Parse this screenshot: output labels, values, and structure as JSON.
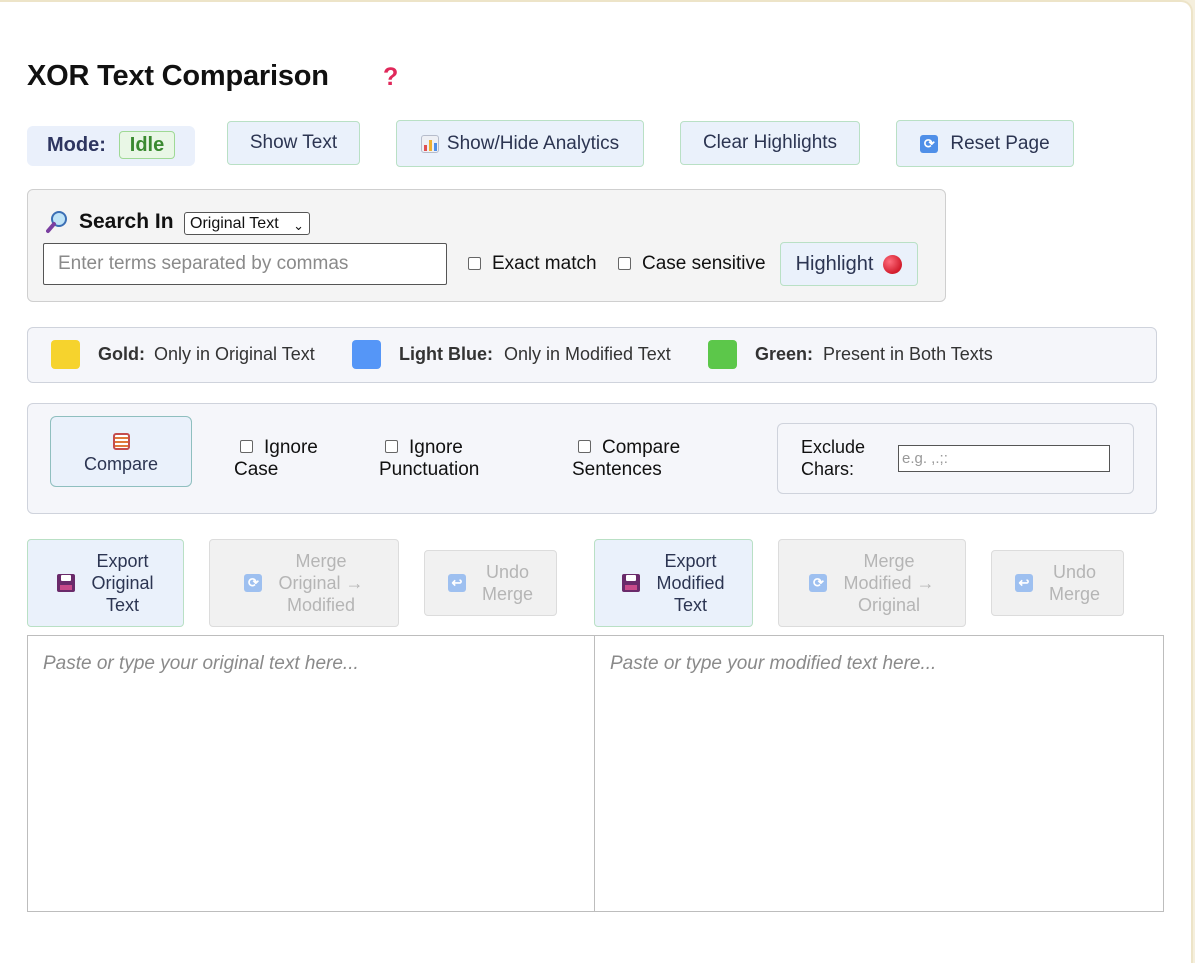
{
  "header": {
    "title": "XOR Text Comparison",
    "help_icon": "?"
  },
  "mode": {
    "label": "Mode:",
    "value": "Idle"
  },
  "toolbar": {
    "show_text": "Show Text",
    "show_hide_analytics": "Show/Hide Analytics",
    "clear_highlights": "Clear Highlights",
    "reset_page": "Reset Page"
  },
  "search": {
    "label": "Search In",
    "select_value": "Original Text",
    "placeholder": "Enter terms separated by commas",
    "exact_match": "Exact match",
    "case_sensitive": "Case sensitive",
    "highlight": "Highlight"
  },
  "legend": [
    {
      "key": "Gold:",
      "text": "Only in Original Text",
      "color": "#f6d32d"
    },
    {
      "key": "Light Blue:",
      "text": "Only in Modified Text",
      "color": "#5596f7"
    },
    {
      "key": "Green:",
      "text": "Present in Both Texts",
      "color": "#5cc74a"
    }
  ],
  "options": {
    "compare": "Compare",
    "ignore_case": [
      "Ignore",
      "Case"
    ],
    "ignore_punctuation": [
      "Ignore",
      "Punctuation"
    ],
    "compare_sentences": [
      "Compare",
      "Sentences"
    ],
    "exclude_chars": [
      "Exclude",
      "Chars:"
    ],
    "exclude_placeholder": "e.g. ,.;:"
  },
  "left_actions": {
    "export": [
      "Export",
      "Original",
      "Text"
    ],
    "merge": [
      "Merge",
      "Original →",
      "Modified"
    ],
    "undo": [
      "Undo",
      "Merge"
    ]
  },
  "right_actions": {
    "export": [
      "Export",
      "Modified",
      "Text"
    ],
    "merge": [
      "Merge",
      "Modified →",
      "Original"
    ],
    "undo": [
      "Undo",
      "Merge"
    ]
  },
  "editors": {
    "original_placeholder": "Paste or type your original text here...",
    "modified_placeholder": "Paste or type your modified text here..."
  }
}
